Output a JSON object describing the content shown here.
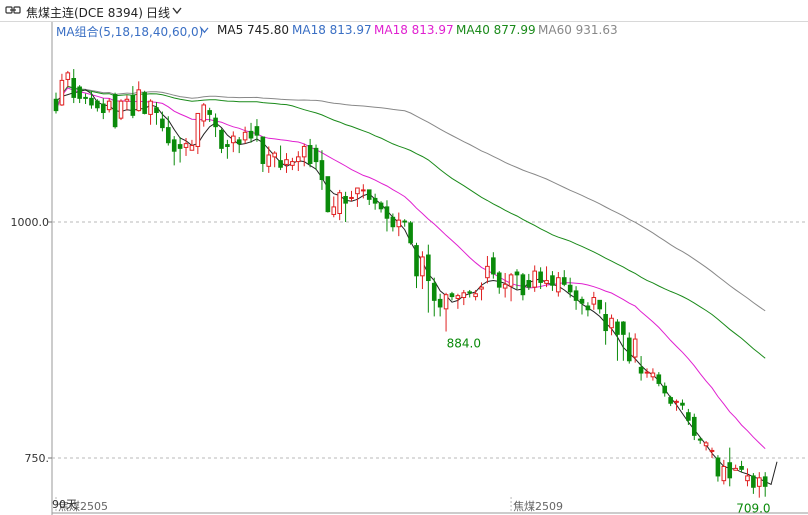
{
  "header": {
    "title": "焦煤主连(DCE 8394)",
    "period": "日线"
  },
  "legend": {
    "group": "MA组合(5,18,18,40,60,0)",
    "items": [
      {
        "label": "MA5 745.80",
        "color": "#222222"
      },
      {
        "label": "MA18 813.97",
        "color": "#3a6fc4"
      },
      {
        "label": "MA18 813.97",
        "color": "#e020d0"
      },
      {
        "label": "MA40 877.99",
        "color": "#1a8a1a"
      },
      {
        "label": "MA60 931.63",
        "color": "#888888"
      }
    ]
  },
  "colors": {
    "up": "#e02020",
    "down": "#0a8a0a",
    "ma5": "#222222",
    "ma18": "#e020d0",
    "ma40": "#1a8a1a",
    "ma60": "#888888"
  },
  "chart_data": {
    "type": "candlestick",
    "y_ticks": [
      1000.0,
      750.0
    ],
    "y_tick_labels": [
      "1000.0",
      "750."
    ],
    "x_labels": [
      {
        "text": "焦煤2505",
        "index": 0
      },
      {
        "text": "焦煤2509",
        "index": 77
      }
    ],
    "corner_label": "90天",
    "annotations": [
      {
        "text": "884.0",
        "index": 69,
        "value": 884.0
      },
      {
        "text": "709.0",
        "index": 118,
        "value": 709.0
      }
    ],
    "candles": [
      [
        1130,
        1118,
        1137,
        1115
      ],
      [
        1124,
        1150,
        1157,
        1123
      ],
      [
        1151,
        1158,
        1160,
        1143
      ],
      [
        1152,
        1132,
        1162,
        1126
      ],
      [
        1143,
        1131,
        1145,
        1126
      ],
      [
        1132,
        1131,
        1136,
        1125
      ],
      [
        1131,
        1124,
        1138,
        1120
      ],
      [
        1128,
        1121,
        1130,
        1117
      ],
      [
        1125,
        1116,
        1131,
        1109
      ],
      [
        1119,
        1128,
        1131,
        1116
      ],
      [
        1135,
        1101,
        1137,
        1099
      ],
      [
        1110,
        1128,
        1130,
        1108
      ],
      [
        1128,
        1130,
        1134,
        1118
      ],
      [
        1134,
        1113,
        1144,
        1110
      ],
      [
        1118,
        1140,
        1149,
        1117
      ],
      [
        1137,
        1115,
        1139,
        1114
      ],
      [
        1114,
        1128,
        1130,
        1103
      ],
      [
        1121,
        1116,
        1127,
        1103
      ],
      [
        1109,
        1100,
        1117,
        1096
      ],
      [
        1100,
        1084,
        1112,
        1081
      ],
      [
        1087,
        1075,
        1091,
        1060
      ],
      [
        1082,
        1078,
        1090,
        1063
      ],
      [
        1079,
        1083,
        1089,
        1070
      ],
      [
        1076,
        1081,
        1087,
        1076
      ],
      [
        1080,
        1115,
        1115,
        1072
      ],
      [
        1107,
        1124,
        1126,
        1101
      ],
      [
        1118,
        1114,
        1121,
        1106
      ],
      [
        1110,
        1101,
        1115,
        1090
      ],
      [
        1097,
        1078,
        1099,
        1073
      ],
      [
        1082,
        1080,
        1087,
        1067
      ],
      [
        1084,
        1091,
        1096,
        1074
      ],
      [
        1087,
        1083,
        1090,
        1073
      ],
      [
        1087,
        1095,
        1101,
        1083
      ],
      [
        1096,
        1089,
        1105,
        1084
      ],
      [
        1101,
        1092,
        1109,
        1085
      ],
      [
        1090,
        1062,
        1090,
        1053
      ],
      [
        1059,
        1071,
        1080,
        1052
      ],
      [
        1069,
        1073,
        1075,
        1058
      ],
      [
        1065,
        1058,
        1081,
        1055
      ],
      [
        1061,
        1066,
        1073,
        1052
      ],
      [
        1060,
        1064,
        1068,
        1055
      ],
      [
        1064,
        1069,
        1075,
        1054
      ],
      [
        1069,
        1080,
        1083,
        1059
      ],
      [
        1081,
        1062,
        1088,
        1058
      ],
      [
        1078,
        1064,
        1082,
        1055
      ],
      [
        1065,
        1045,
        1076,
        1034
      ],
      [
        1048,
        1011,
        1048,
        1010
      ],
      [
        1008,
        1016,
        1027,
        1005
      ],
      [
        1009,
        1031,
        1034,
        1002
      ],
      [
        1027,
        1020,
        1032,
        1000
      ],
      [
        1025,
        1026,
        1033,
        1022
      ],
      [
        1030,
        1036,
        1036,
        1016
      ],
      [
        1033,
        1034,
        1040,
        1025
      ],
      [
        1034,
        1024,
        1034,
        1018
      ],
      [
        1025,
        1020,
        1030,
        1013
      ],
      [
        1020,
        1014,
        1022,
        1010
      ],
      [
        1016,
        1004,
        1023,
        990
      ],
      [
        1005,
        995,
        1009,
        990
      ],
      [
        995,
        1002,
        1010,
        985
      ],
      [
        1001,
        1000,
        1003,
        995
      ],
      [
        999,
        978,
        1001,
        976
      ],
      [
        975,
        943,
        978,
        930
      ],
      [
        943,
        963,
        969,
        929
      ],
      [
        965,
        938,
        976,
        904
      ],
      [
        935,
        917,
        941,
        900
      ],
      [
        918,
        910,
        924,
        900
      ],
      [
        908,
        923,
        925,
        884
      ],
      [
        924,
        921,
        926,
        917
      ],
      [
        919,
        922,
        924,
        908
      ],
      [
        920,
        925,
        928,
        912
      ],
      [
        926,
        925,
        928,
        920
      ],
      [
        921,
        924,
        928,
        917
      ],
      [
        929,
        931,
        936,
        917
      ],
      [
        941,
        953,
        964,
        935
      ],
      [
        962,
        945,
        968,
        940
      ],
      [
        946,
        931,
        948,
        924
      ],
      [
        930,
        934,
        946,
        920
      ],
      [
        932,
        944,
        946,
        916
      ],
      [
        947,
        944,
        950,
        929
      ],
      [
        944,
        923,
        946,
        917
      ],
      [
        938,
        931,
        945,
        928
      ],
      [
        931,
        948,
        954,
        926
      ],
      [
        947,
        936,
        952,
        929
      ],
      [
        935,
        938,
        953,
        931
      ],
      [
        943,
        933,
        948,
        927
      ],
      [
        926,
        941,
        947,
        921
      ],
      [
        941,
        934,
        949,
        932
      ],
      [
        933,
        926,
        941,
        920
      ],
      [
        927,
        917,
        932,
        907
      ],
      [
        918,
        914,
        921,
        902
      ],
      [
        911,
        907,
        915,
        900
      ],
      [
        913,
        920,
        926,
        907
      ],
      [
        917,
        908,
        917,
        903
      ],
      [
        902,
        885,
        915,
        870
      ],
      [
        888,
        898,
        902,
        880
      ],
      [
        894,
        881,
        897,
        853
      ],
      [
        894,
        881,
        895,
        853
      ],
      [
        877,
        853,
        883,
        850
      ],
      [
        857,
        876,
        882,
        851
      ],
      [
        846,
        840,
        858,
        832
      ],
      [
        840,
        841,
        845,
        835
      ],
      [
        836,
        840,
        845,
        832
      ],
      [
        838,
        829,
        841,
        826
      ],
      [
        826,
        819,
        830,
        815
      ],
      [
        814,
        808,
        816,
        805
      ],
      [
        809,
        810,
        812,
        800
      ],
      [
        808,
        806,
        812,
        801
      ],
      [
        798,
        790,
        802,
        785
      ],
      [
        793,
        774,
        797,
        769
      ],
      [
        770,
        769,
        772,
        765
      ],
      [
        763,
        766,
        768,
        758
      ],
      [
        758,
        758,
        761,
        750
      ],
      [
        750,
        731,
        753,
        725
      ],
      [
        726,
        741,
        748,
        722
      ],
      [
        745,
        729,
        761,
        720
      ],
      [
        737,
        739,
        743,
        737
      ],
      [
        741,
        738,
        747,
        735
      ],
      [
        726,
        731,
        739,
        720
      ],
      [
        731,
        719,
        734,
        712
      ],
      [
        720,
        729,
        735,
        708
      ],
      [
        730,
        720,
        735,
        709
      ]
    ],
    "ma5": [
      1128,
      1133,
      1135,
      1137,
      1138,
      1140,
      1136,
      1127,
      1124,
      1123,
      1118,
      1117,
      1119,
      1118,
      1120,
      1120,
      1124,
      1122,
      1114,
      1108,
      1098,
      1089,
      1086,
      1081,
      1083,
      1093,
      1101,
      1105,
      1100,
      1092,
      1087,
      1082,
      1083,
      1085,
      1088,
      1084,
      1077,
      1070,
      1063,
      1059,
      1062,
      1065,
      1064,
      1060,
      1056,
      1047,
      1036,
      1030,
      1028,
      1023,
      1022,
      1024,
      1028,
      1030,
      1024,
      1019,
      1012,
      1005,
      999,
      992,
      979,
      968,
      958,
      945,
      938,
      927,
      922,
      915,
      917,
      922,
      924,
      926,
      933,
      937,
      938,
      937,
      935,
      931,
      928,
      929,
      936,
      938,
      940,
      935,
      934,
      932,
      928,
      923,
      919,
      913,
      909,
      905,
      900,
      893,
      887,
      878,
      867,
      861,
      855,
      848,
      842,
      838,
      832,
      823,
      814,
      806,
      797,
      788,
      780,
      772,
      764,
      755,
      748,
      741,
      739,
      738,
      735,
      733,
      730,
      728,
      725,
      722,
      746
    ]
  }
}
